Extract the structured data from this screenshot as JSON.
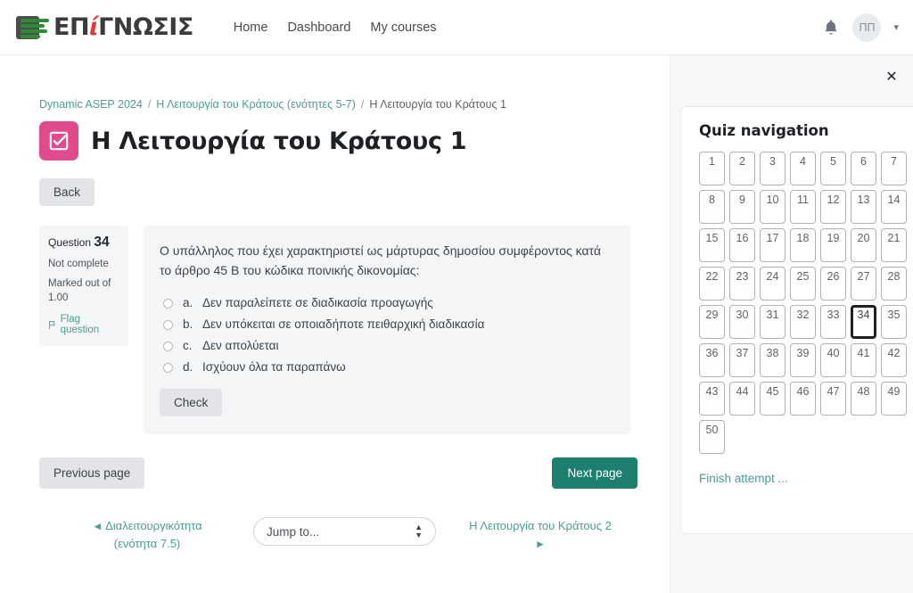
{
  "navbar": {
    "brand_prefix": "ΕΠ",
    "brand_i": "ί",
    "brand_suffix": "ΓΝΩΣΙΣ",
    "links": [
      {
        "label": "Home"
      },
      {
        "label": "Dashboard"
      },
      {
        "label": "My courses"
      }
    ],
    "notification_icon": "bell-icon",
    "avatar_initials": "ΠΠ",
    "caret_icon": "chevron-down-icon"
  },
  "breadcrumb": {
    "items": [
      {
        "label": "Dynamic ASEP 2024",
        "link": true
      },
      {
        "label": "Η Λειτουργία του Κράτους (ενότητες 5-7)",
        "link": true
      },
      {
        "label": "Η Λειτουργία του Κράτους 1",
        "link": false
      }
    ],
    "separator": "/"
  },
  "page": {
    "title": "Η Λειτουργία του Κράτους 1",
    "icon": "quiz-checkbox-icon",
    "icon_color": "#e24a8e",
    "back_label": "Back"
  },
  "question": {
    "label": "Question",
    "number": "34",
    "state": "Not complete",
    "marked_out_of": "Marked out of 1.00",
    "flag_label": "Flag question",
    "flag_icon": "flag-icon",
    "text": "Ο υπάλληλος που έχει χαρακτηριστεί ως μάρτυρας δημοσίου συμφέροντος κατά το άρθρο 45 Β του κώδικα ποινικής δικονομίας:",
    "answers": [
      {
        "key": "a.",
        "text": "Δεν παραλείπετε σε διαδικασία προαγωγής",
        "selected": false
      },
      {
        "key": "b.",
        "text": "Δεν υπόκειται σε οποιαδήποτε πειθαρχική διαδικασία",
        "selected": false
      },
      {
        "key": "c.",
        "text": "Δεν απολύεται",
        "selected": false
      },
      {
        "key": "d.",
        "text": "Ισχύουν όλα τα παραπάνω",
        "selected": false
      }
    ],
    "check_label": "Check"
  },
  "pagenav": {
    "previous_label": "Previous page",
    "next_label": "Next page",
    "next_color": "#1d7f6e"
  },
  "footnav": {
    "prev_arrow": "◄",
    "prev_line1": "Διαλειτουργικότητα",
    "prev_line2": "(ενότητα 7.5)",
    "jump_label": "Jump to...",
    "jump_icon": "select-spinner-icon",
    "next_label": "Η Λειτουργία του Κράτους 2",
    "next_arrow": "►"
  },
  "drawer": {
    "close_icon": "close-icon",
    "title": "Quiz navigation",
    "buttons": [
      "1",
      "2",
      "3",
      "4",
      "5",
      "6",
      "7",
      "8",
      "9",
      "10",
      "11",
      "12",
      "13",
      "14",
      "15",
      "16",
      "17",
      "18",
      "19",
      "20",
      "21",
      "22",
      "23",
      "24",
      "25",
      "26",
      "27",
      "28",
      "29",
      "30",
      "31",
      "32",
      "33",
      "34",
      "35",
      "36",
      "37",
      "38",
      "39",
      "40",
      "41",
      "42",
      "43",
      "44",
      "45",
      "46",
      "47",
      "48",
      "49",
      "50"
    ],
    "current_button": "34",
    "finish_label": "Finish attempt ..."
  }
}
